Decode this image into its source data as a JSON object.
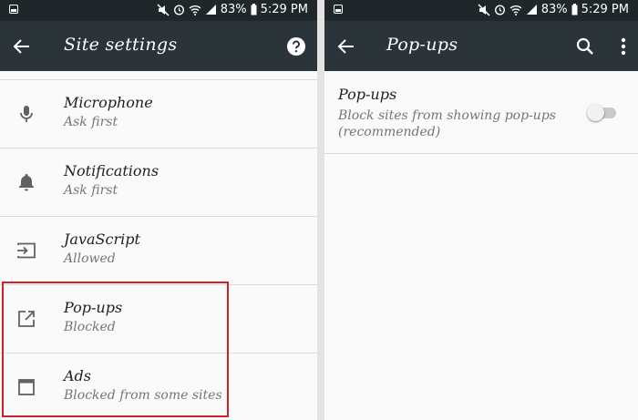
{
  "status_bar": {
    "battery": "83%",
    "time": "5:29 PM"
  },
  "left_screen": {
    "title": "Site settings",
    "items": [
      {
        "name": "Microphone",
        "sub": "Ask first",
        "icon": "microphone-icon"
      },
      {
        "name": "Notifications",
        "sub": "Ask first",
        "icon": "bell-icon"
      },
      {
        "name": "JavaScript",
        "sub": "Allowed",
        "icon": "javascript-icon"
      },
      {
        "name": "Pop-ups",
        "sub": "Blocked",
        "icon": "external-link-icon"
      },
      {
        "name": "Ads",
        "sub": "Blocked from some sites",
        "icon": "window-icon"
      }
    ]
  },
  "right_screen": {
    "title": "Pop-ups",
    "setting": {
      "name": "Pop-ups",
      "description": "Block sites from showing pop-ups (recommended)",
      "enabled": false
    }
  },
  "colors": {
    "status_bar": "#1f272b",
    "app_bar": "#2b3438",
    "highlight": "#cc2128"
  }
}
